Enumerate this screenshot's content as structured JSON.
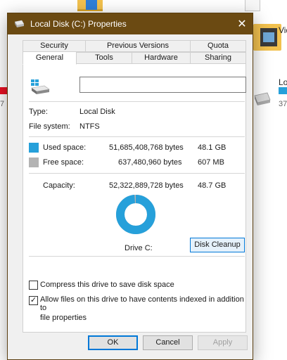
{
  "background": {
    "video_label": "Vid",
    "drive_label": "Lo",
    "drive_size": "37",
    "left_size": "7"
  },
  "window": {
    "title": "Local Disk (C:) Properties",
    "close_glyph": "✕"
  },
  "tabs": {
    "row1": [
      "Security",
      "Previous Versions",
      "Quota"
    ],
    "row2": [
      "General",
      "Tools",
      "Hardware",
      "Sharing"
    ],
    "active": "General"
  },
  "general": {
    "name_value": "",
    "type_label": "Type:",
    "type_value": "Local Disk",
    "fs_label": "File system:",
    "fs_value": "NTFS",
    "used": {
      "label": "Used space:",
      "bytes": "51,685,408,768 bytes",
      "size": "48.1 GB",
      "color": "#26a0da"
    },
    "free": {
      "label": "Free space:",
      "bytes": "637,480,960 bytes",
      "size": "607 MB",
      "color": "#b3b3b3"
    },
    "capacity": {
      "label": "Capacity:",
      "bytes": "52,322,889,728 bytes",
      "size": "48.7 GB"
    },
    "used_fraction": 0.988,
    "drive_label": "Drive C:",
    "cleanup_button": "Disk Cleanup",
    "compress_label": "Compress this drive to save disk space",
    "compress_checked": false,
    "index_label_line1": "Allow files on this drive to have contents indexed in addition to",
    "index_label_line2": "file properties",
    "index_checked": true
  },
  "buttons": {
    "ok": "OK",
    "cancel": "Cancel",
    "apply": "Apply"
  }
}
